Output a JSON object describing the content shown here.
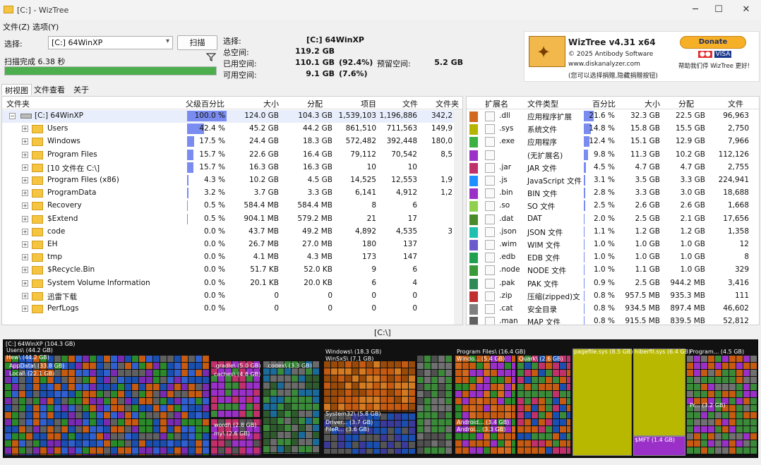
{
  "window": {
    "title": "[C:] - WizTree"
  },
  "menu": {
    "file": "文件(Z)",
    "options": "选项(Y)"
  },
  "select_label": "选择:",
  "drive_value": "[C:] 64WinXP",
  "scan_button": "扫描",
  "scan_status": "扫描完成 6.38 秒",
  "progress_fraction": 1.0,
  "info": {
    "selected_label": "选择:",
    "selected_value": "[C:] 64WinXP",
    "total_label": "总空间:",
    "total_value": "119.2 GB",
    "used_label": "已用空间:",
    "used_value": "110.1 GB",
    "used_pct": "(92.4%)",
    "reserved_label": "预留空间:",
    "reserved_value": "5.2 GB",
    "free_label": "可用空间:",
    "free_value": "9.1 GB",
    "free_pct": "(7.6%)"
  },
  "brand": {
    "title": "WizTree v4.31 x64",
    "copyright": "© 2025 Antibody Software",
    "site": "www.diskanalyzer.com",
    "note": "(您可以选择捐赠,隐藏捐赠按钮)",
    "donate": "Donate",
    "help": "帮助我们停 WizTree 更好!"
  },
  "tabs": [
    "树视图",
    "文件查看",
    "关于"
  ],
  "tree": {
    "headers": [
      "文件夹",
      "父级百分比",
      "大小",
      "分配",
      "项目",
      "文件",
      "文件夹"
    ],
    "rows": [
      {
        "name": "[C:] 64WinXP",
        "pct": "100.0 %",
        "pct_num": 100,
        "size": "124.0 GB",
        "alloc": "104.3 GB",
        "items": "1,539,103",
        "files": "1,196,886",
        "folders": "342,2"
      },
      {
        "name": "Users",
        "pct": "42.4 %",
        "pct_num": 42.4,
        "size": "45.2 GB",
        "alloc": "44.2 GB",
        "items": "861,510",
        "files": "711,563",
        "folders": "149,9"
      },
      {
        "name": "Windows",
        "pct": "17.5 %",
        "pct_num": 17.5,
        "size": "24.4 GB",
        "alloc": "18.3 GB",
        "items": "572,482",
        "files": "392,448",
        "folders": "180,0"
      },
      {
        "name": "Program Files",
        "pct": "15.7 %",
        "pct_num": 15.7,
        "size": "22.6 GB",
        "alloc": "16.4 GB",
        "items": "79,112",
        "files": "70,542",
        "folders": "8,5"
      },
      {
        "name": "[10 文件在 C:\\]",
        "pct": "15.7 %",
        "pct_num": 15.7,
        "size": "16.3 GB",
        "alloc": "16.3 GB",
        "items": "10",
        "files": "10",
        "folders": ""
      },
      {
        "name": "Program Files (x86)",
        "pct": "4.3 %",
        "pct_num": 4.3,
        "size": "10.2 GB",
        "alloc": "4.5 GB",
        "items": "14,525",
        "files": "12,553",
        "folders": "1,9"
      },
      {
        "name": "ProgramData",
        "pct": "3.2 %",
        "pct_num": 3.2,
        "size": "3.7 GB",
        "alloc": "3.3 GB",
        "items": "6,141",
        "files": "4,912",
        "folders": "1,2"
      },
      {
        "name": "Recovery",
        "pct": "0.5 %",
        "pct_num": 0.5,
        "size": "584.4 MB",
        "alloc": "584.4 MB",
        "items": "8",
        "files": "6",
        "folders": ""
      },
      {
        "name": "$Extend",
        "pct": "0.5 %",
        "pct_num": 0.5,
        "size": "904.1 MB",
        "alloc": "579.2 MB",
        "items": "21",
        "files": "17",
        "folders": ""
      },
      {
        "name": "code",
        "pct": "0.0 %",
        "pct_num": 0,
        "size": "43.7 MB",
        "alloc": "49.2 MB",
        "items": "4,892",
        "files": "4,535",
        "folders": "3"
      },
      {
        "name": "EH",
        "pct": "0.0 %",
        "pct_num": 0,
        "size": "26.7 MB",
        "alloc": "27.0 MB",
        "items": "180",
        "files": "137",
        "folders": ""
      },
      {
        "name": "tmp",
        "pct": "0.0 %",
        "pct_num": 0,
        "size": "4.1 MB",
        "alloc": "4.3 MB",
        "items": "173",
        "files": "147",
        "folders": ""
      },
      {
        "name": "$Recycle.Bin",
        "pct": "0.0 %",
        "pct_num": 0,
        "size": "51.7 KB",
        "alloc": "52.0 KB",
        "items": "9",
        "files": "6",
        "folders": ""
      },
      {
        "name": "System Volume Information",
        "pct": "0.0 %",
        "pct_num": 0,
        "size": "20.1 KB",
        "alloc": "20.0 KB",
        "items": "6",
        "files": "4",
        "folders": ""
      },
      {
        "name": "迅雷下载",
        "pct": "0.0 %",
        "pct_num": 0,
        "size": "0",
        "alloc": "0",
        "items": "0",
        "files": "0",
        "folders": ""
      },
      {
        "name": "PerfLogs",
        "pct": "0.0 %",
        "pct_num": 0,
        "size": "0",
        "alloc": "0",
        "items": "0",
        "files": "0",
        "folders": ""
      }
    ]
  },
  "types": {
    "headers": [
      "扩展名",
      "文件类型",
      "百分比",
      "大小",
      "分配",
      "文件"
    ],
    "rows": [
      {
        "color": "#d2691e",
        "ext": ".dll",
        "type": "应用程序扩展",
        "pct": "21.6 %",
        "pct_num": 21.6,
        "size": "32.3 GB",
        "alloc": "22.5 GB",
        "files": "96,963"
      },
      {
        "color": "#b5b500",
        "ext": ".sys",
        "type": "系统文件",
        "pct": "14.8 %",
        "pct_num": 14.8,
        "size": "15.8 GB",
        "alloc": "15.5 GB",
        "files": "2,750"
      },
      {
        "color": "#3cb043",
        "ext": ".exe",
        "type": "应用程序",
        "pct": "12.4 %",
        "pct_num": 12.4,
        "size": "15.1 GB",
        "alloc": "12.9 GB",
        "files": "7,966"
      },
      {
        "color": "#9b30c8",
        "ext": "",
        "type": "(无扩展名)",
        "pct": "9.8 %",
        "pct_num": 9.8,
        "size": "11.3 GB",
        "alloc": "10.2 GB",
        "files": "112,126"
      },
      {
        "color": "#c0306a",
        "ext": ".jar",
        "type": "JAR 文件",
        "pct": "4.5 %",
        "pct_num": 4.5,
        "size": "4.7 GB",
        "alloc": "4.7 GB",
        "files": "2,755"
      },
      {
        "color": "#1e90ff",
        "ext": ".js",
        "type": "JavaScript 文件",
        "pct": "3.1 %",
        "pct_num": 3.1,
        "size": "3.5 GB",
        "alloc": "3.3 GB",
        "files": "224,941"
      },
      {
        "color": "#9b30c8",
        "ext": ".bin",
        "type": "BIN 文件",
        "pct": "2.8 %",
        "pct_num": 2.8,
        "size": "3.3 GB",
        "alloc": "3.0 GB",
        "files": "18,688"
      },
      {
        "color": "#8fd14f",
        "ext": ".so",
        "type": "SO 文件",
        "pct": "2.5 %",
        "pct_num": 2.5,
        "size": "2.6 GB",
        "alloc": "2.6 GB",
        "files": "1,668"
      },
      {
        "color": "#4a8a2a",
        "ext": ".dat",
        "type": "DAT",
        "pct": "2.0 %",
        "pct_num": 2.0,
        "size": "2.5 GB",
        "alloc": "2.1 GB",
        "files": "17,656"
      },
      {
        "color": "#20c0b0",
        "ext": ".json",
        "type": "JSON 文件",
        "pct": "1.1 %",
        "pct_num": 1.1,
        "size": "1.2 GB",
        "alloc": "1.2 GB",
        "files": "1,358"
      },
      {
        "color": "#6a5acd",
        "ext": ".wim",
        "type": "WIM 文件",
        "pct": "1.0 %",
        "pct_num": 1.0,
        "size": "1.0 GB",
        "alloc": "1.0 GB",
        "files": "12"
      },
      {
        "color": "#20a050",
        "ext": ".edb",
        "type": "EDB 文件",
        "pct": "1.0 %",
        "pct_num": 1.0,
        "size": "1.0 GB",
        "alloc": "1.0 GB",
        "files": "8"
      },
      {
        "color": "#3a9a3a",
        "ext": ".node",
        "type": "NODE 文件",
        "pct": "1.0 %",
        "pct_num": 1.0,
        "size": "1.1 GB",
        "alloc": "1.0 GB",
        "files": "329"
      },
      {
        "color": "#2e8b57",
        "ext": ".pak",
        "type": "PAK 文件",
        "pct": "0.9 %",
        "pct_num": 0.9,
        "size": "2.5 GB",
        "alloc": "944.2 MB",
        "files": "3,416"
      },
      {
        "color": "#c03030",
        "ext": ".zip",
        "type": "压缩(zipped)文",
        "pct": "0.8 %",
        "pct_num": 0.8,
        "size": "957.5 MB",
        "alloc": "935.3 MB",
        "files": "111"
      },
      {
        "color": "#808080",
        "ext": ".cat",
        "type": "安全目录",
        "pct": "0.8 %",
        "pct_num": 0.8,
        "size": "934.5 MB",
        "alloc": "897.4 MB",
        "files": "46,602"
      },
      {
        "color": "#606060",
        "ext": ".man",
        "type": "MAP 文件",
        "pct": "0.8 %",
        "pct_num": 0.8,
        "size": "915.5 MB",
        "alloc": "839.5 MB",
        "files": "52,812"
      }
    ]
  },
  "treemap_path": "[C:\\]",
  "treemap": {
    "root": "[C:] 64WinXP   (104.3 GB)",
    "labels": [
      "Users\\ (44.2 GB)",
      "Hew\\ (44.2 GB)",
      "AppData\\ (33.8 GB)",
      "Local\\ (22.1 GB)",
      ".gradle\\ (5.0 GB)",
      "caches\\ (4.8 GB)",
      ".codex\\ (3.3 GB)",
      "wordl\\ (2.8 GB)",
      "my\\ (2.6 GB)",
      "Windows\\ (18.3 GB)",
      "WinSxS\\ (7.1 GB)",
      "System32\\ (5.8 GB)",
      "Driver... (3.7 GB)",
      "FileR... (3.6 GB)",
      "Program Files\\ (16.4 GB)",
      "Windo... (5.4 GB)",
      "Quark\\ (2.6 GB)",
      "Android... (3.4 GB)",
      "Androi... (3.3 GB)",
      "pagefile.sys (8.5 GB)",
      "hiberfil.sys (6.4 GB)",
      "$MFT (1.4 GB)",
      "Program... (4.5 GB)",
      "Pr... (3.2 GB)"
    ]
  }
}
